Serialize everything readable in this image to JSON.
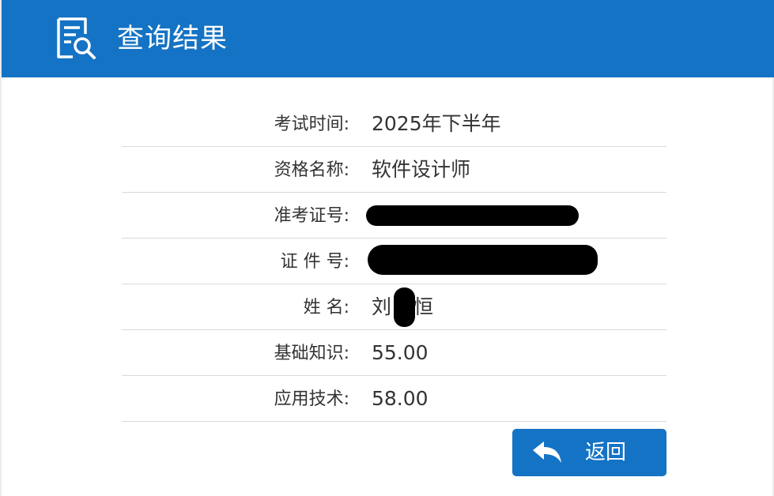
{
  "header": {
    "title": "查询结果",
    "icon": "document-search-icon",
    "background": "#1473c4"
  },
  "results": [
    {
      "label": "考试时间:",
      "value": "2025年下半年"
    },
    {
      "label": "资格名称:",
      "value": "软件设计师"
    },
    {
      "label": "准考证号:",
      "value": ""
    },
    {
      "label": "证 件 号:",
      "value": ""
    },
    {
      "label": "姓    名:",
      "value_prefix": "刘",
      "value_suffix": "恒"
    },
    {
      "label": "基础知识:",
      "value": "55.00"
    },
    {
      "label": "应用技术:",
      "value": "58.00"
    }
  ],
  "actions": {
    "back_label": "返回",
    "back_icon": "reply-arrow-icon",
    "button_color": "#1473c4"
  }
}
